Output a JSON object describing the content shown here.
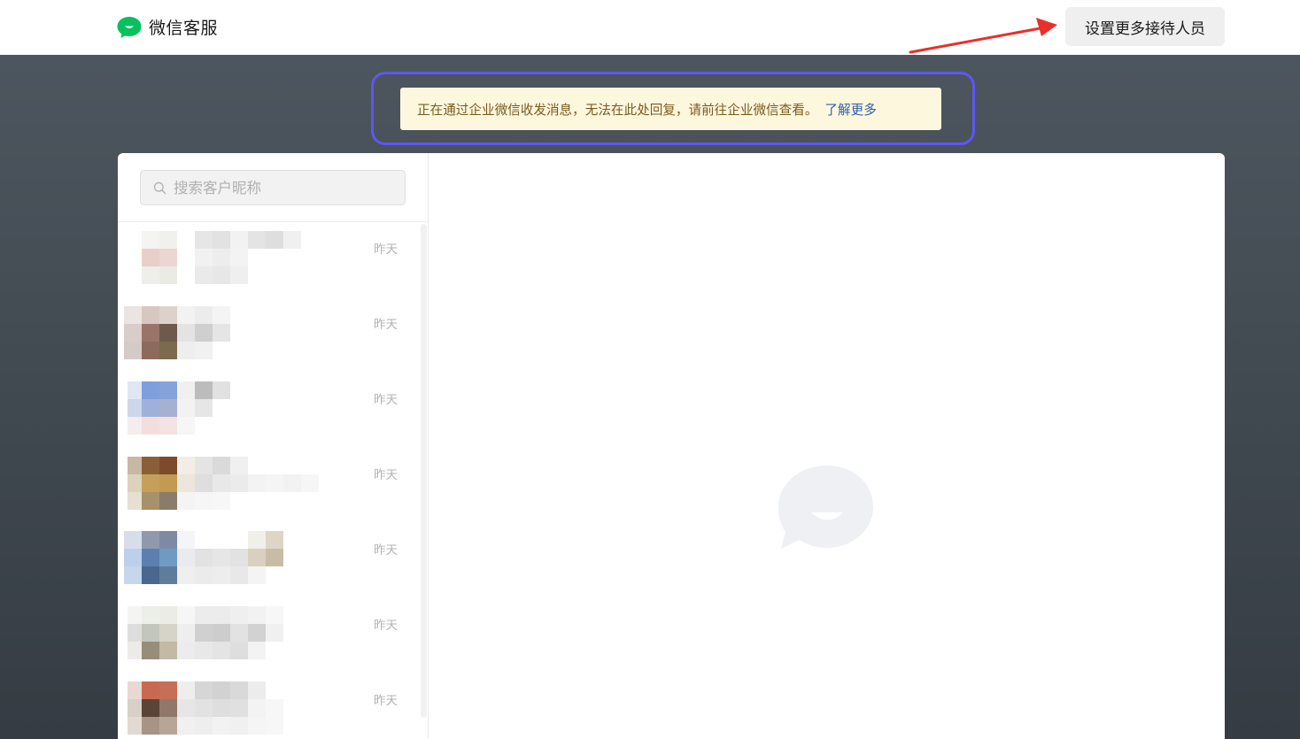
{
  "app": {
    "title": "微信客服",
    "logo_icon": "wechat-kefu-logo-icon",
    "accent": "#07c160"
  },
  "header": {
    "settings_button": "设置更多接待人员"
  },
  "notice": {
    "text": "正在通过企业微信收发消息，无法在此处回复，请前往企业微信查看。",
    "link": "了解更多",
    "highlight_color": "#5d57f2"
  },
  "search": {
    "placeholder": "搜索客户昵称",
    "icon": "search-icon"
  },
  "conversations": [
    {
      "time": "昨天"
    },
    {
      "time": "昨天"
    },
    {
      "time": "昨天"
    },
    {
      "time": "昨天"
    },
    {
      "time": "昨天"
    },
    {
      "time": "昨天"
    },
    {
      "time": "昨天"
    }
  ],
  "chat": {
    "empty_state_icon": "chat-bubble-icon"
  }
}
